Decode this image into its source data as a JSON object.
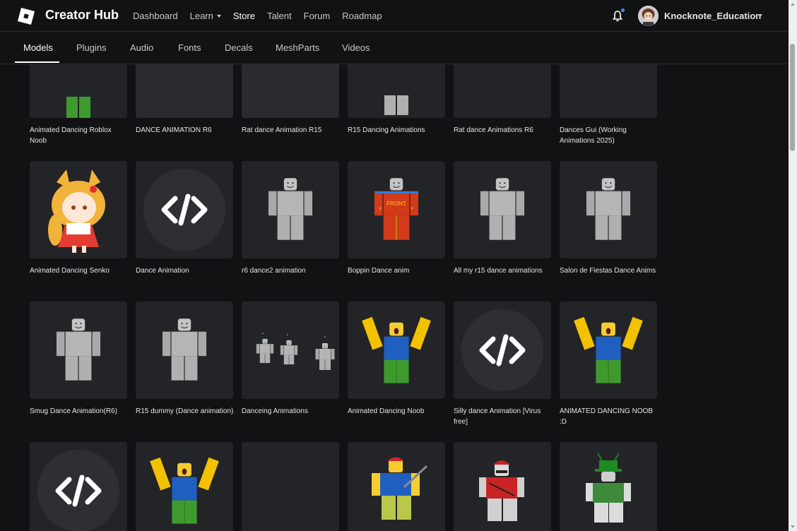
{
  "header": {
    "brand": "Creator Hub",
    "nav": [
      {
        "label": "Dashboard",
        "dropdown": false,
        "active": false
      },
      {
        "label": "Learn",
        "dropdown": true,
        "active": false
      },
      {
        "label": "Store",
        "dropdown": false,
        "active": true
      },
      {
        "label": "Talent",
        "dropdown": false,
        "active": false
      },
      {
        "label": "Forum",
        "dropdown": false,
        "active": false
      },
      {
        "label": "Roadmap",
        "dropdown": false,
        "active": false
      }
    ],
    "username": "Knocknote_Education",
    "notification_icon": "bell-icon"
  },
  "tabs": [
    "Models",
    "Plugins",
    "Audio",
    "Fonts",
    "Decals",
    "MeshParts",
    "Videos"
  ],
  "active_tab": "Models",
  "colors": {
    "background": "#111214",
    "card": "#232427",
    "notification_dot": "#3b8cff",
    "text": "#e6e6e6"
  },
  "models": [
    {
      "title": "Animated Dancing Roblox Noob",
      "thumb": "noob-partial"
    },
    {
      "title": "DANCE ANIMATION R6",
      "thumb": "gradient"
    },
    {
      "title": "Rat dance Animation R15",
      "thumb": "gradient"
    },
    {
      "title": "R15 Dancing Animations",
      "thumb": "gray-partial"
    },
    {
      "title": "Rat dance Animations R6",
      "thumb": "blank"
    },
    {
      "title": "Dances Gui (Working Animations 2025)",
      "thumb": "blank"
    },
    {
      "title": "Animated Dancing Senko",
      "thumb": "senko"
    },
    {
      "title": "Dance Animation",
      "thumb": "code"
    },
    {
      "title": "r6 dance2 animation",
      "thumb": "gray-dummy"
    },
    {
      "title": "Boppin Dance anim",
      "thumb": "front-dummy"
    },
    {
      "title": "All my r15 dance animations",
      "thumb": "gray-dummy"
    },
    {
      "title": "Salon de Fiestas Dance Anims",
      "thumb": "gray-dummy"
    },
    {
      "title": "Smug Dance Animation(R6)",
      "thumb": "gray-dummy"
    },
    {
      "title": "R15 dummy (Dance animation)",
      "thumb": "gray-dummy"
    },
    {
      "title": "Danceing Animations",
      "thumb": "three-dummies"
    },
    {
      "title": "Animated Dancing Noob",
      "thumb": "noob"
    },
    {
      "title": "Silly dance Animation [Virus free]",
      "thumb": "code"
    },
    {
      "title": "ANIMATED DANCING NOOB :D",
      "thumb": "noob"
    },
    {
      "title": "",
      "thumb": "code"
    },
    {
      "title": "",
      "thumb": "noob"
    },
    {
      "title": "",
      "thumb": "blank"
    },
    {
      "title": "",
      "thumb": "blue-guitar"
    },
    {
      "title": "",
      "thumb": "red-cap"
    },
    {
      "title": "",
      "thumb": "green-hat"
    }
  ]
}
